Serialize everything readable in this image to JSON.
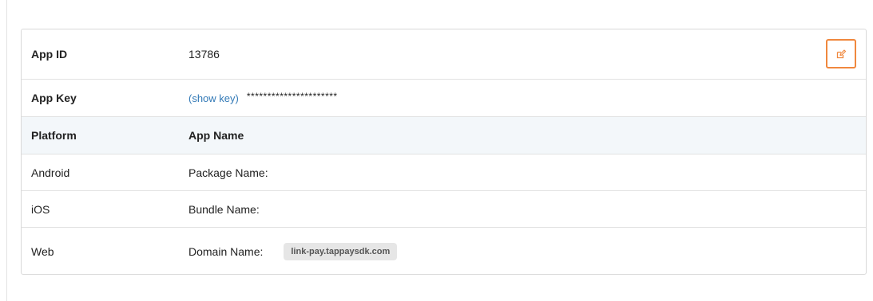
{
  "app": {
    "id_label": "App ID",
    "id_value": "13786",
    "key_label": "App Key",
    "show_key_label": "(show key)",
    "key_masked": "**********************"
  },
  "table": {
    "header_platform": "Platform",
    "header_app_name": "App Name",
    "rows": [
      {
        "platform": "Android",
        "field_label": "Package Name:"
      },
      {
        "platform": "iOS",
        "field_label": "Bundle Name:"
      },
      {
        "platform": "Web",
        "field_label": "Domain Name:",
        "value": "link-pay.tappaysdk.com"
      }
    ]
  },
  "icons": {
    "edit": "edit-icon"
  },
  "colors": {
    "accent": "#f0883e",
    "link": "#337ab7",
    "header_bg": "#f3f7fa"
  }
}
